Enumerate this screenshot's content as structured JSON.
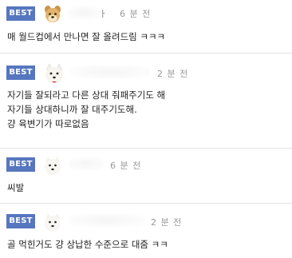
{
  "comments": [
    {
      "badge": "BEST",
      "avatar": "shiba-puppy-avatar",
      "nickname_fragment": "ㅏ",
      "time": "6 분 전",
      "lines": [
        "매 월드컵에서 만나면 잘 올려드림 ㅋㅋㅋ"
      ]
    },
    {
      "badge": "BEST",
      "avatar": "white-dog-avatar",
      "time": "2 분 전",
      "lines": [
        "자기들 잘되라고 다른 상대 줘패주기도 해",
        "자기들 상대하니까 잘 대주기도해.",
        "걍 육변기가 따로없음"
      ]
    },
    {
      "badge": "BEST",
      "avatar": "white-dog-avatar",
      "time": "6 분 전",
      "lines": [
        "씨발"
      ]
    },
    {
      "badge": "BEST",
      "avatar": "white-dog-avatar",
      "time": "2 분 전",
      "lines": [
        "골 먹힌거도 걍 상납한 수준으로 대줌 ㅋㅋ"
      ]
    }
  ],
  "colors": {
    "badge_bg": "#5677bf",
    "badge_text": "#ffffff",
    "time_text": "#9a9a9a",
    "divider": "#e3e3e3"
  }
}
